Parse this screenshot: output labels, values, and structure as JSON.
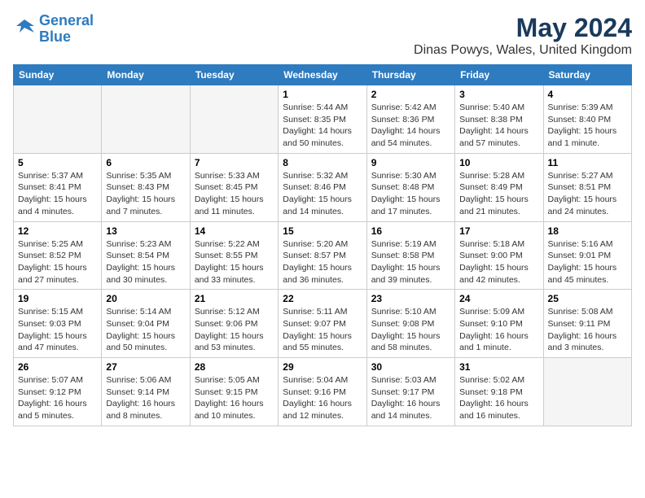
{
  "logo": {
    "line1": "General",
    "line2": "Blue"
  },
  "title": "May 2024",
  "subtitle": "Dinas Powys, Wales, United Kingdom",
  "weekdays": [
    "Sunday",
    "Monday",
    "Tuesday",
    "Wednesday",
    "Thursday",
    "Friday",
    "Saturday"
  ],
  "weeks": [
    [
      {
        "day": "",
        "info": ""
      },
      {
        "day": "",
        "info": ""
      },
      {
        "day": "",
        "info": ""
      },
      {
        "day": "1",
        "info": "Sunrise: 5:44 AM\nSunset: 8:35 PM\nDaylight: 14 hours\nand 50 minutes."
      },
      {
        "day": "2",
        "info": "Sunrise: 5:42 AM\nSunset: 8:36 PM\nDaylight: 14 hours\nand 54 minutes."
      },
      {
        "day": "3",
        "info": "Sunrise: 5:40 AM\nSunset: 8:38 PM\nDaylight: 14 hours\nand 57 minutes."
      },
      {
        "day": "4",
        "info": "Sunrise: 5:39 AM\nSunset: 8:40 PM\nDaylight: 15 hours\nand 1 minute."
      }
    ],
    [
      {
        "day": "5",
        "info": "Sunrise: 5:37 AM\nSunset: 8:41 PM\nDaylight: 15 hours\nand 4 minutes."
      },
      {
        "day": "6",
        "info": "Sunrise: 5:35 AM\nSunset: 8:43 PM\nDaylight: 15 hours\nand 7 minutes."
      },
      {
        "day": "7",
        "info": "Sunrise: 5:33 AM\nSunset: 8:45 PM\nDaylight: 15 hours\nand 11 minutes."
      },
      {
        "day": "8",
        "info": "Sunrise: 5:32 AM\nSunset: 8:46 PM\nDaylight: 15 hours\nand 14 minutes."
      },
      {
        "day": "9",
        "info": "Sunrise: 5:30 AM\nSunset: 8:48 PM\nDaylight: 15 hours\nand 17 minutes."
      },
      {
        "day": "10",
        "info": "Sunrise: 5:28 AM\nSunset: 8:49 PM\nDaylight: 15 hours\nand 21 minutes."
      },
      {
        "day": "11",
        "info": "Sunrise: 5:27 AM\nSunset: 8:51 PM\nDaylight: 15 hours\nand 24 minutes."
      }
    ],
    [
      {
        "day": "12",
        "info": "Sunrise: 5:25 AM\nSunset: 8:52 PM\nDaylight: 15 hours\nand 27 minutes."
      },
      {
        "day": "13",
        "info": "Sunrise: 5:23 AM\nSunset: 8:54 PM\nDaylight: 15 hours\nand 30 minutes."
      },
      {
        "day": "14",
        "info": "Sunrise: 5:22 AM\nSunset: 8:55 PM\nDaylight: 15 hours\nand 33 minutes."
      },
      {
        "day": "15",
        "info": "Sunrise: 5:20 AM\nSunset: 8:57 PM\nDaylight: 15 hours\nand 36 minutes."
      },
      {
        "day": "16",
        "info": "Sunrise: 5:19 AM\nSunset: 8:58 PM\nDaylight: 15 hours\nand 39 minutes."
      },
      {
        "day": "17",
        "info": "Sunrise: 5:18 AM\nSunset: 9:00 PM\nDaylight: 15 hours\nand 42 minutes."
      },
      {
        "day": "18",
        "info": "Sunrise: 5:16 AM\nSunset: 9:01 PM\nDaylight: 15 hours\nand 45 minutes."
      }
    ],
    [
      {
        "day": "19",
        "info": "Sunrise: 5:15 AM\nSunset: 9:03 PM\nDaylight: 15 hours\nand 47 minutes."
      },
      {
        "day": "20",
        "info": "Sunrise: 5:14 AM\nSunset: 9:04 PM\nDaylight: 15 hours\nand 50 minutes."
      },
      {
        "day": "21",
        "info": "Sunrise: 5:12 AM\nSunset: 9:06 PM\nDaylight: 15 hours\nand 53 minutes."
      },
      {
        "day": "22",
        "info": "Sunrise: 5:11 AM\nSunset: 9:07 PM\nDaylight: 15 hours\nand 55 minutes."
      },
      {
        "day": "23",
        "info": "Sunrise: 5:10 AM\nSunset: 9:08 PM\nDaylight: 15 hours\nand 58 minutes."
      },
      {
        "day": "24",
        "info": "Sunrise: 5:09 AM\nSunset: 9:10 PM\nDaylight: 16 hours\nand 1 minute."
      },
      {
        "day": "25",
        "info": "Sunrise: 5:08 AM\nSunset: 9:11 PM\nDaylight: 16 hours\nand 3 minutes."
      }
    ],
    [
      {
        "day": "26",
        "info": "Sunrise: 5:07 AM\nSunset: 9:12 PM\nDaylight: 16 hours\nand 5 minutes."
      },
      {
        "day": "27",
        "info": "Sunrise: 5:06 AM\nSunset: 9:14 PM\nDaylight: 16 hours\nand 8 minutes."
      },
      {
        "day": "28",
        "info": "Sunrise: 5:05 AM\nSunset: 9:15 PM\nDaylight: 16 hours\nand 10 minutes."
      },
      {
        "day": "29",
        "info": "Sunrise: 5:04 AM\nSunset: 9:16 PM\nDaylight: 16 hours\nand 12 minutes."
      },
      {
        "day": "30",
        "info": "Sunrise: 5:03 AM\nSunset: 9:17 PM\nDaylight: 16 hours\nand 14 minutes."
      },
      {
        "day": "31",
        "info": "Sunrise: 5:02 AM\nSunset: 9:18 PM\nDaylight: 16 hours\nand 16 minutes."
      },
      {
        "day": "",
        "info": ""
      }
    ]
  ]
}
